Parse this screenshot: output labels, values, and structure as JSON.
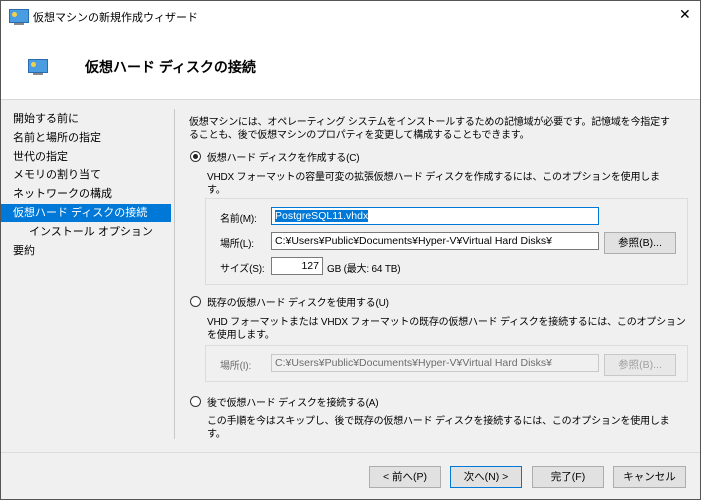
{
  "window": {
    "title": "仮想マシンの新規作成ウィザード",
    "close_glyph": "✕"
  },
  "header": {
    "title": "仮想ハード ディスクの接続"
  },
  "nav": {
    "items": [
      {
        "label": "開始する前に"
      },
      {
        "label": "名前と場所の指定"
      },
      {
        "label": "世代の指定"
      },
      {
        "label": "メモリの割り当て"
      },
      {
        "label": "ネットワークの構成"
      },
      {
        "label": "仮想ハード ディスクの接続",
        "selected": true
      },
      {
        "label": "インストール オプション"
      },
      {
        "label": "要約"
      }
    ]
  },
  "content": {
    "intro_line1": "仮想マシンには、オペレーティング システムをインストールするための記憶域が必要です。記憶域を今指定す",
    "intro_line2": "ることも、後で仮想マシンのプロパティを変更して構成することもできます。",
    "create": {
      "label": "仮想ハード ディスクを作成する(C)",
      "checked": true,
      "desc1": "VHDX フォーマットの容量可変の拡張仮想ハード ディスクを作成するには、このオプションを使用しま",
      "desc2": "す。",
      "name_label": "名前(M):",
      "name_value": "PostgreSQL11.vhdx",
      "location_label": "場所(L):",
      "location_value": "C:¥Users¥Public¥Documents¥Hyper-V¥Virtual Hard Disks¥",
      "browse_label": "参照(B)...",
      "size_label": "サイズ(S):",
      "size_value": "127",
      "size_unit": "GB (最大: 64 TB)"
    },
    "existing": {
      "label": "既存の仮想ハード ディスクを使用する(U)",
      "checked": false,
      "desc1": "VHD フォーマットまたは VHDX フォーマットの既存の仮想ハード ディスクを接続するには、このオプション",
      "desc2": "を使用します。",
      "location_label": "場所(I):",
      "location_value": "C:¥Users¥Public¥Documents¥Hyper-V¥Virtual Hard Disks¥",
      "browse_label": "参照(B)..."
    },
    "later": {
      "label": "後で仮想ハード ディスクを接続する(A)",
      "checked": false,
      "desc1": "この手順を今はスキップし、後で既存の仮想ハード ディスクを接続するには、このオプションを使用しま",
      "desc2": "す。"
    }
  },
  "footer": {
    "prev": "< 前へ(P)",
    "next": "次へ(N) >",
    "finish": "完了(F)",
    "cancel": "キャンセル"
  }
}
